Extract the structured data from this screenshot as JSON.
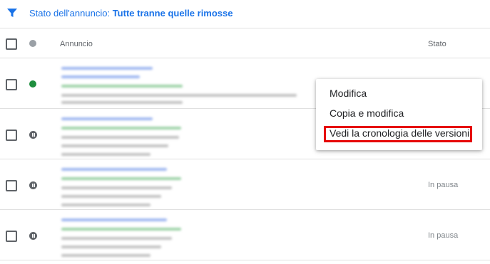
{
  "filter": {
    "label": "Stato dell'annuncio:",
    "value": "Tutte tranne quelle rimosse"
  },
  "columns": {
    "ad": "Annuncio",
    "status": "Stato"
  },
  "rows": [
    {
      "status_dot": "green",
      "status_label": ""
    },
    {
      "status_dot": "paused",
      "status_label": ""
    },
    {
      "status_dot": "paused",
      "status_label": "In pausa"
    },
    {
      "status_dot": "paused",
      "status_label": "In pausa"
    }
  ],
  "context_menu": {
    "items": [
      "Modifica",
      "Copia e modifica",
      "Vedi la cronologia delle versioni"
    ]
  },
  "colors": {
    "accent": "#1a73e8",
    "enabled": "#1e8e3e",
    "highlight_border": "#e60000"
  },
  "icons": {
    "filter": "filter-icon",
    "pause": "pause-icon"
  }
}
